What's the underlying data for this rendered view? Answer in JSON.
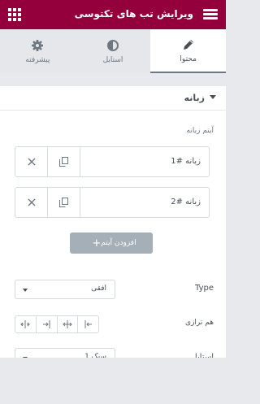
{
  "header": {
    "title": "ویرایش تب های تکتوسی",
    "hamburger_icon": "hamburger-menu-icon",
    "grid_icon": "apps-grid-icon"
  },
  "tabs": [
    {
      "label": "محتوا",
      "icon": "pencil-icon",
      "active": true
    },
    {
      "label": "استایل",
      "icon": "half-circle-icon",
      "active": false
    },
    {
      "label": "پیشرفته",
      "icon": "gear-icon",
      "active": false
    }
  ],
  "section": {
    "title": "زبانه"
  },
  "items_label": "آیتم زبانه",
  "items": [
    {
      "title": "زبانه #1"
    },
    {
      "title": "زبانه #2"
    }
  ],
  "add_button": {
    "label": "افزودن آیتم"
  },
  "type_control": {
    "label": "Type",
    "value": "افقی"
  },
  "alignment_control": {
    "label": "هم ترازی",
    "options": [
      "align-start-icon",
      "align-center-icon",
      "align-end-icon",
      "align-justify-icon"
    ]
  },
  "style_control": {
    "label": "استایل",
    "value": "سبک 1"
  },
  "colors": {
    "header_bg": "#93003c",
    "button_bg": "#a4afb7",
    "border": "#d5dadf"
  }
}
